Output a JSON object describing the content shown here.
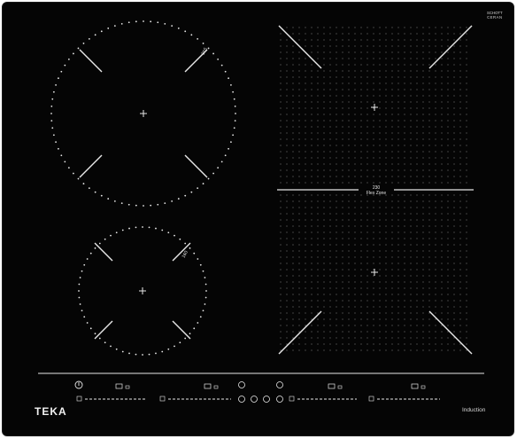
{
  "brand": {
    "name": "TEKA",
    "technology": "Induction"
  },
  "glass": {
    "line1": "SCHOTT",
    "line2": "CERAN"
  },
  "zones": {
    "front_left_large": {
      "size_label": "215"
    },
    "rear_left_small": {
      "size_label": "160"
    },
    "flex": {
      "size_label": "230",
      "name": "Flex Zone"
    }
  },
  "colors": {
    "glass": "#050505",
    "markings": "#e8e8e8"
  },
  "icons": {
    "power": "power-icon",
    "pot": "pot-icon",
    "lock": "lock-icon",
    "timer": "timer-icon",
    "plus": "plus-icon",
    "minus": "minus-icon"
  }
}
